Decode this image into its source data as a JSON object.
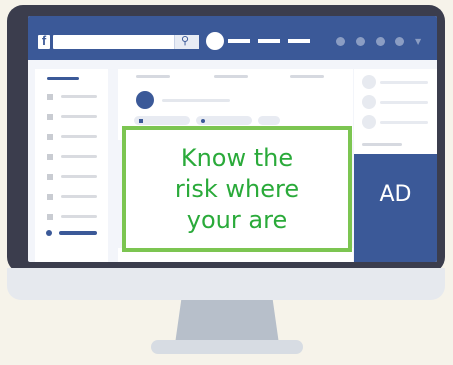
{
  "header": {
    "logo_glyph": "f",
    "search_glyph": "⚲"
  },
  "callout": {
    "text": "Know the\nrisk where\nyour are"
  },
  "ad": {
    "label": "AD"
  },
  "colors": {
    "brand": "#3b5998",
    "callout_border": "#7cc551",
    "callout_text": "#2aaa3a"
  }
}
